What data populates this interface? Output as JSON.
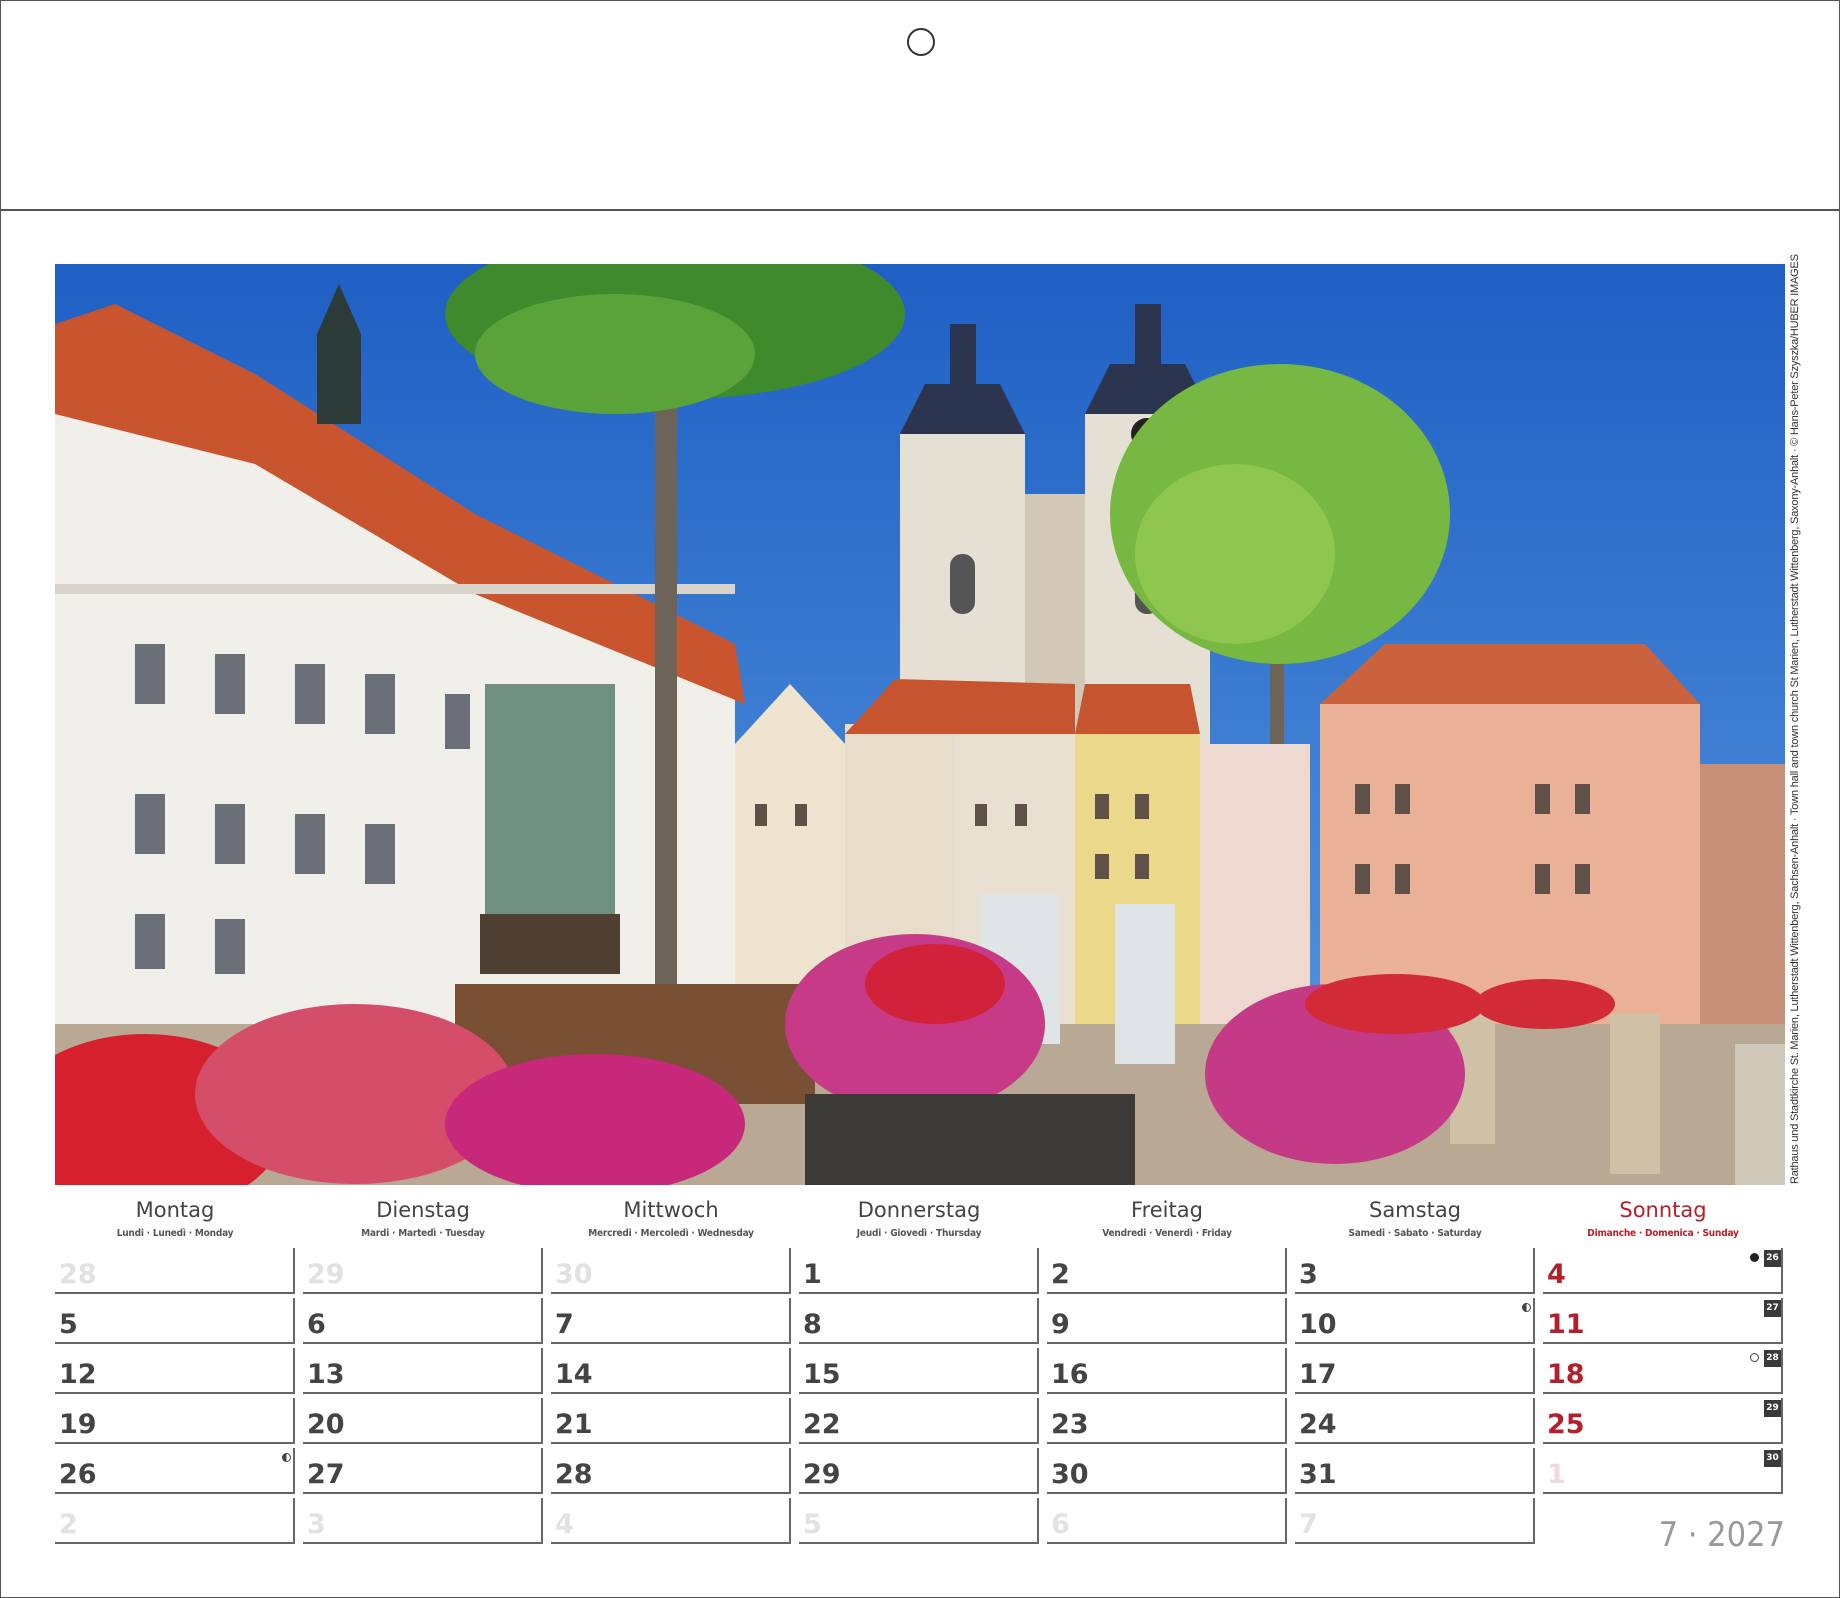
{
  "caption": "Rathaus und Stadtkirche St. Marien, Lutherstadt Wittenberg, Sachsen-Anhalt · Town hall and town church St Marien, Lutherstadt Wittenberg, Saxony-Anhalt · © Hans-Peter Szyszka/HUBER IMAGES",
  "weekdays": [
    {
      "name": "Montag",
      "translations": "Lundi · Lunedì · Monday"
    },
    {
      "name": "Dienstag",
      "translations": "Mardi · Martedì · Tuesday"
    },
    {
      "name": "Mittwoch",
      "translations": "Mercredi · Mercoledì · Wednesday"
    },
    {
      "name": "Donnerstag",
      "translations": "Jeudi · Giovedì · Thursday"
    },
    {
      "name": "Freitag",
      "translations": "Vendredi · Venerdì · Friday"
    },
    {
      "name": "Samstag",
      "translations": "Samedi · Sabato · Saturday"
    },
    {
      "name": "Sonntag",
      "translations": "Dimanche · Domenica · Sunday"
    }
  ],
  "weeks": [
    {
      "days": [
        "28",
        "29",
        "30",
        "1",
        "2",
        "3",
        "4"
      ],
      "week_no": "26"
    },
    {
      "days": [
        "5",
        "6",
        "7",
        "8",
        "9",
        "10",
        "11"
      ],
      "week_no": "27"
    },
    {
      "days": [
        "12",
        "13",
        "14",
        "15",
        "16",
        "17",
        "18"
      ],
      "week_no": "28"
    },
    {
      "days": [
        "19",
        "20",
        "21",
        "22",
        "23",
        "24",
        "25"
      ],
      "week_no": "29"
    },
    {
      "days": [
        "26",
        "27",
        "28",
        "29",
        "30",
        "31",
        "1"
      ],
      "week_no": "30"
    },
    {
      "days": [
        "2",
        "3",
        "4",
        "5",
        "6",
        "7",
        ""
      ],
      "week_no": ""
    }
  ],
  "outside_month": [
    [
      true,
      true,
      true,
      false,
      false,
      false,
      false
    ],
    [
      false,
      false,
      false,
      false,
      false,
      false,
      false
    ],
    [
      false,
      false,
      false,
      false,
      false,
      false,
      false
    ],
    [
      false,
      false,
      false,
      false,
      false,
      false,
      false
    ],
    [
      false,
      false,
      false,
      false,
      false,
      false,
      true
    ],
    [
      true,
      true,
      true,
      true,
      true,
      true,
      true
    ]
  ],
  "moon_phases": [
    {
      "week": 0,
      "weekday": 6,
      "phase": "new-moon-icon"
    },
    {
      "week": 1,
      "weekday": 5,
      "phase": "first-quarter-icon"
    },
    {
      "week": 2,
      "weekday": 6,
      "phase": "full-moon-icon"
    },
    {
      "week": 4,
      "weekday": 0,
      "phase": "last-quarter-icon"
    }
  ],
  "month_year": "7 · 2027",
  "colors": {
    "sunday": "#b3202a",
    "text": "#444444",
    "muted": "#999999"
  }
}
